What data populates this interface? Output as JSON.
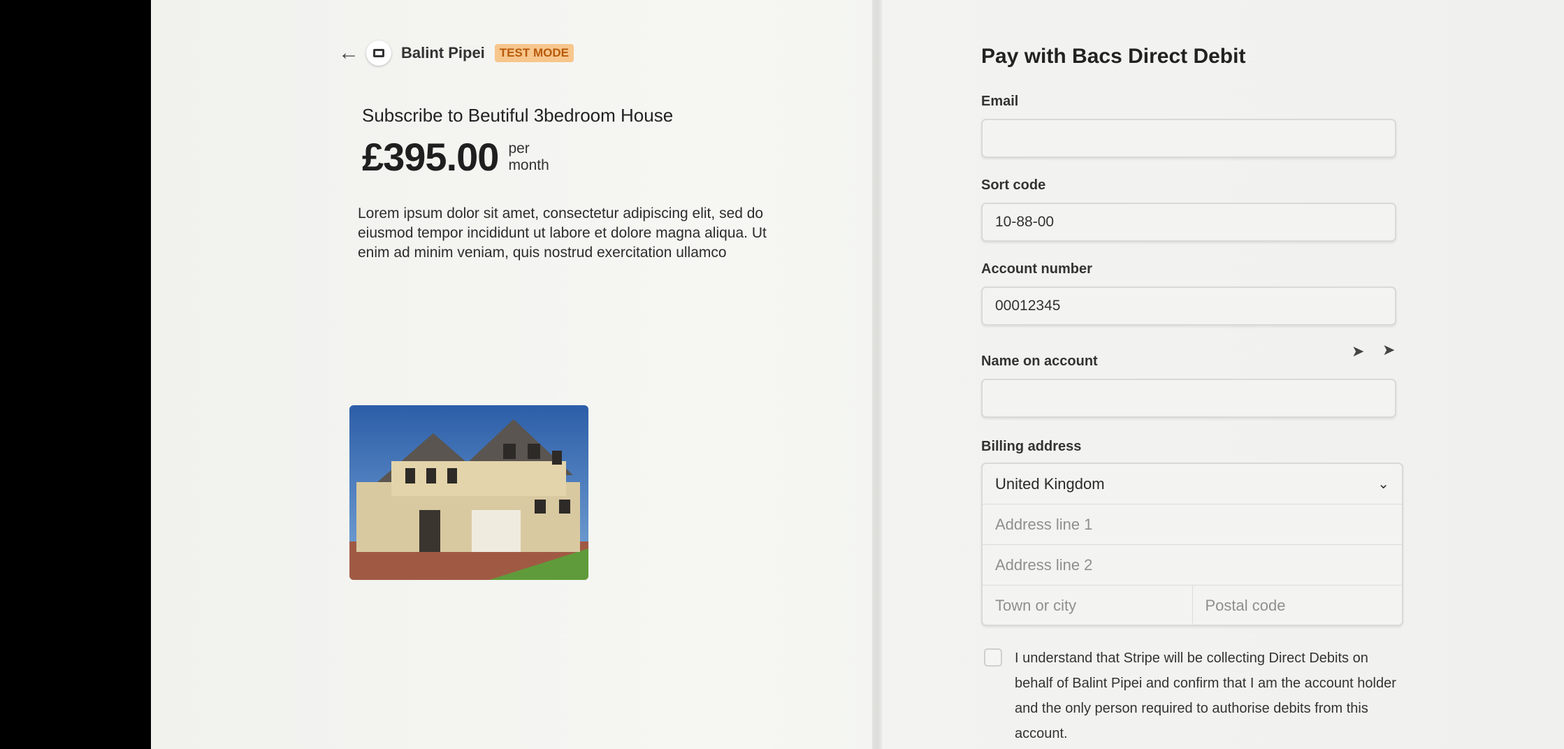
{
  "header": {
    "back_icon": "arrow-left-icon",
    "merchant_name": "Balint Pipei",
    "test_badge": "TEST MODE"
  },
  "product": {
    "title": "Subscribe to Beutiful 3bedroom House",
    "price": "£395.00",
    "per_line1": "per",
    "per_line2": "month",
    "description": "Lorem ipsum dolor sit amet, consectetur adipiscing elit, sed do eiusmod tempor incididunt ut labore et dolore magna aliqua. Ut enim ad minim veniam, quis nostrud exercitation ullamco"
  },
  "form": {
    "title": "Pay with Bacs Direct Debit",
    "email": {
      "label": "Email",
      "value": ""
    },
    "sort_code": {
      "label": "Sort code",
      "value": "10-88-00"
    },
    "account_number": {
      "label": "Account number",
      "value": "00012345"
    },
    "name_on_account": {
      "label": "Name on account",
      "value": ""
    },
    "billing": {
      "label": "Billing address",
      "country": "United Kingdom",
      "address_line1_placeholder": "Address line 1",
      "address_line2_placeholder": "Address line 2",
      "town_placeholder": "Town or city",
      "postal_placeholder": "Postal code"
    },
    "consent_text": "I understand that Stripe will be collecting Direct Debits on behalf of Balint Pipei and confirm that I am the account holder and the only person required to authorise debits from this account."
  },
  "colors": {
    "badge_bg": "#f7c68c",
    "badge_text": "#b75a0b",
    "background": "#f3f3f1"
  }
}
